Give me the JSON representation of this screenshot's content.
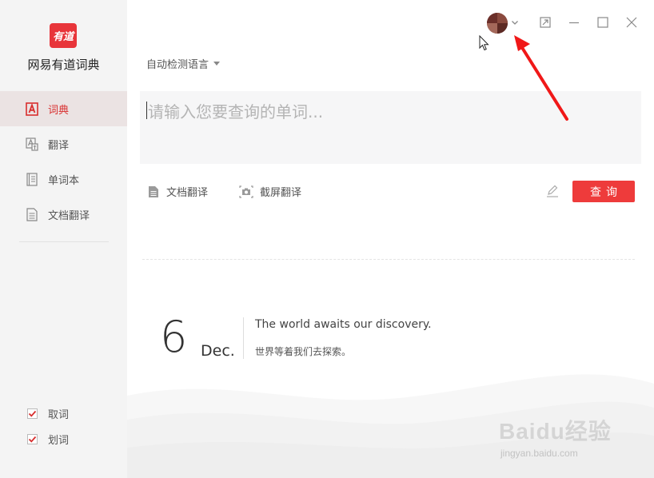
{
  "app": {
    "logo_text": "有道",
    "name": "网易有道词典"
  },
  "sidebar": {
    "items": [
      {
        "label": "词典",
        "icon": "dictionary-icon",
        "active": true
      },
      {
        "label": "翻译",
        "icon": "translate-icon",
        "active": false
      },
      {
        "label": "单词本",
        "icon": "wordbook-icon",
        "active": false
      },
      {
        "label": "文档翻译",
        "icon": "document-icon",
        "active": false
      }
    ],
    "options": [
      {
        "label": "取词",
        "checked": true
      },
      {
        "label": "划词",
        "checked": true
      }
    ]
  },
  "header": {
    "avatar_icon": "user-avatar",
    "controls": [
      "dropdown-chevron-icon",
      "shrink-window-icon",
      "minimize-icon",
      "maximize-icon",
      "close-icon"
    ]
  },
  "search": {
    "language_selector": "自动检测语言",
    "placeholder": "请输入您要查询的单词...",
    "value": "",
    "submit_label": "查询"
  },
  "tools": {
    "doc_translate": "文档翻译",
    "screenshot_translate": "截屏翻译"
  },
  "daily": {
    "day": "6",
    "month": "Dec.",
    "quote_en": "The world awaits our discovery.",
    "quote_zh": "世界等着我们去探索。"
  },
  "watermark": {
    "line1": "Baidu经验",
    "line2": "jingyan.baidu.com"
  },
  "colors": {
    "accent": "#ee3b3b",
    "brand": "#e8353a",
    "sidebar_bg": "#f4f4f4",
    "active_bg": "#ebe3e3",
    "annotation": "#f01818"
  }
}
